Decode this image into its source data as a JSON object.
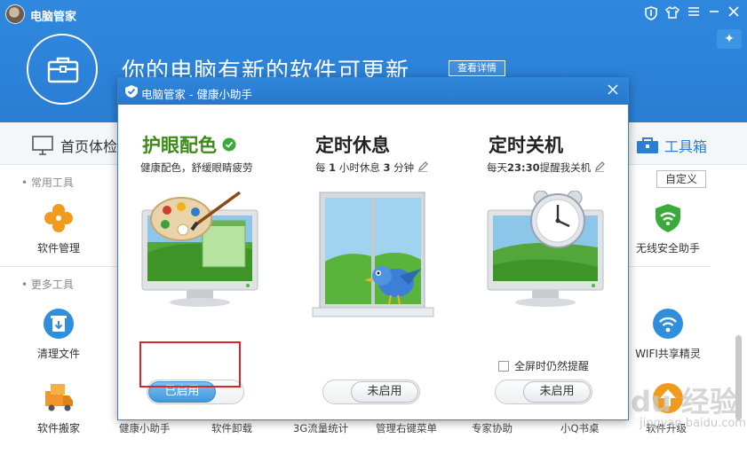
{
  "app": {
    "title": "电脑管家",
    "headline": "你的电脑有新的软件可更新",
    "details_button": "查看详情"
  },
  "nav": {
    "home_label": "首页体检",
    "toolbox_label": "工具箱"
  },
  "sections": {
    "common_tools": "• 常用工具",
    "more_tools": "• 更多工具",
    "customize_button": "自定义"
  },
  "tools": {
    "software_manager": "软件管理",
    "wireless_security": "无线安全助手",
    "clean_files": "清理文件",
    "wifi_share": "WIFI共享精灵",
    "software_move": "软件搬家"
  },
  "bottom_labels": [
    "健康小助手",
    "软件卸载",
    "3G流量统计",
    "管理右键菜单",
    "专家协助",
    "小Q书桌",
    "软件升级"
  ],
  "dialog": {
    "title": "电脑管家 - 健康小助手",
    "eye_care": {
      "title": "护眼配色",
      "subtitle": "健康配色，舒缓眼睛疲劳",
      "toggle_label": "已启用",
      "enabled": true
    },
    "rest_reminder": {
      "title": "定时休息",
      "sub_prefix": "每",
      "hours": "1",
      "sub_middle": "小时休息",
      "minutes": "3",
      "sub_suffix": "分钟",
      "toggle_label": "未启用",
      "enabled": false
    },
    "shutdown": {
      "title": "定时关机",
      "sub_prefix": "每天",
      "time": "23:30",
      "sub_suffix": "提醒我关机",
      "fullscreen_label": "全屏时仍然提醒",
      "toggle_label": "未启用",
      "enabled": false
    }
  },
  "watermark": {
    "brand": "Bai du 经验",
    "url": "jingyan.baidu.com"
  },
  "colors": {
    "brand_blue": "#2a7ed4",
    "eye_green": "#3d8a1a",
    "highlight_red": "#d9262c"
  }
}
